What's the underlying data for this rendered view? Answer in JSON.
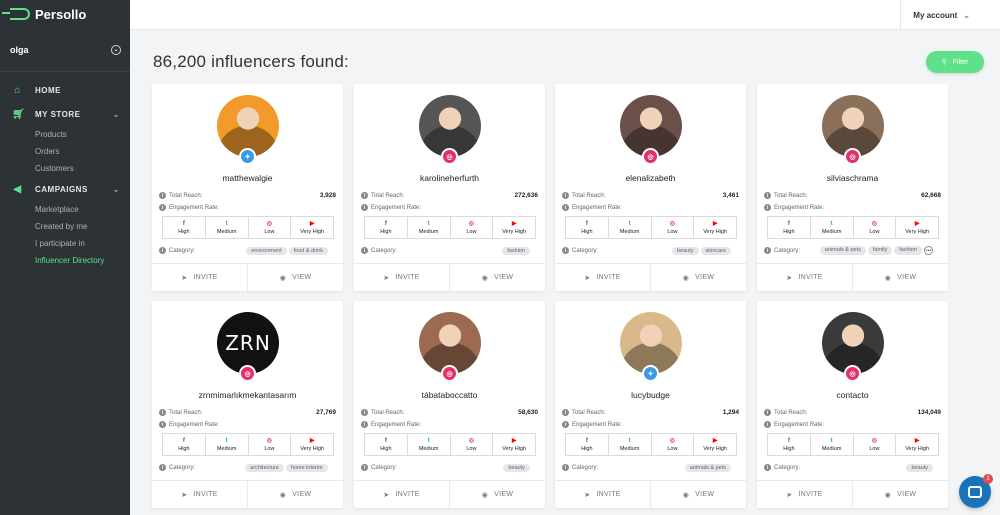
{
  "app": {
    "name": "Persollo"
  },
  "sidebar": {
    "user": "olga",
    "nav": [
      {
        "label": "HOME",
        "icon": "home-icon"
      },
      {
        "label": "MY STORE",
        "icon": "cart-icon",
        "children": [
          "Products",
          "Orders",
          "Customers"
        ]
      },
      {
        "label": "CAMPAIGNS",
        "icon": "megaphone-icon",
        "children": [
          "Marketplace",
          "Created by me",
          "I participate in",
          "Influencer Directory"
        ]
      }
    ]
  },
  "header": {
    "account_label": "My account"
  },
  "main": {
    "heading": "86,200 influencers found:",
    "filter_label": "Filter"
  },
  "labels": {
    "reach": "Total Reach:",
    "engagement": "Engagement Rate:",
    "category": "Category:",
    "invite": "INVITE",
    "view": "VIEW"
  },
  "engagement_columns": [
    {
      "icon": "f",
      "color": "#3b5998"
    },
    {
      "icon": "t",
      "color": "#1da1f2"
    },
    {
      "icon": "◎",
      "color": "#e1306c"
    },
    {
      "icon": "▶",
      "color": "#ff0000"
    }
  ],
  "cards": [
    {
      "username": "matthewalgie",
      "network": "twitter",
      "reach": "3,928",
      "engagement": [
        "High",
        "Medium",
        "Low",
        "Very High"
      ],
      "tags": [
        "environment",
        "food & drink"
      ],
      "avatar_color": "#f39a2c"
    },
    {
      "username": "karolineherfurth",
      "network": "instagram",
      "reach": "272,636",
      "engagement": [
        "High",
        "Medium",
        "Low",
        "Very High"
      ],
      "tags": [
        "fashion"
      ],
      "avatar_color": "#555555"
    },
    {
      "username": "elenalizabeth",
      "network": "instagram",
      "reach": "3,461",
      "engagement": [
        "High",
        "Medium",
        "Low",
        "Very High"
      ],
      "tags": [
        "beauty",
        "skincare"
      ],
      "avatar_color": "#6a5048"
    },
    {
      "username": "silviaschrama",
      "network": "instagram",
      "reach": "62,668",
      "engagement": [
        "High",
        "Medium",
        "Low",
        "Very High"
      ],
      "tags": [
        "animals & pets",
        "family",
        "fashion"
      ],
      "more": true,
      "avatar_color": "#8a6f5a"
    },
    {
      "username": "zrnmimarlıkmekantasarım",
      "network": "instagram",
      "reach": "27,769",
      "engagement": [
        "High",
        "Medium",
        "Low",
        "Very High"
      ],
      "tags": [
        "architecture",
        "home interior"
      ],
      "avatar_color": "#111111",
      "avatar_text": "ZRN"
    },
    {
      "username": "tábataboccatto",
      "network": "instagram",
      "reach": "58,630",
      "engagement": [
        "High",
        "Medium",
        "Low",
        "Very High"
      ],
      "tags": [
        "beauty"
      ],
      "avatar_color": "#9c6b4f"
    },
    {
      "username": "lucybudge",
      "network": "twitter",
      "reach": "1,294",
      "engagement": [
        "High",
        "Medium",
        "Low",
        "Very High"
      ],
      "tags": [
        "animals & pets"
      ],
      "avatar_color": "#d9b98a"
    },
    {
      "username": "contacto",
      "network": "instagram",
      "reach": "134,049",
      "engagement": [
        "High",
        "Medium",
        "Low",
        "Very High"
      ],
      "tags": [
        "beauty"
      ],
      "avatar_color": "#3b3b3b"
    }
  ],
  "chat": {
    "unread": "1"
  },
  "colors": {
    "accent": "#5fe08a",
    "sidebar": "#2c3236",
    "twitter": "#3c9be8",
    "instagram": "#e1306c"
  }
}
